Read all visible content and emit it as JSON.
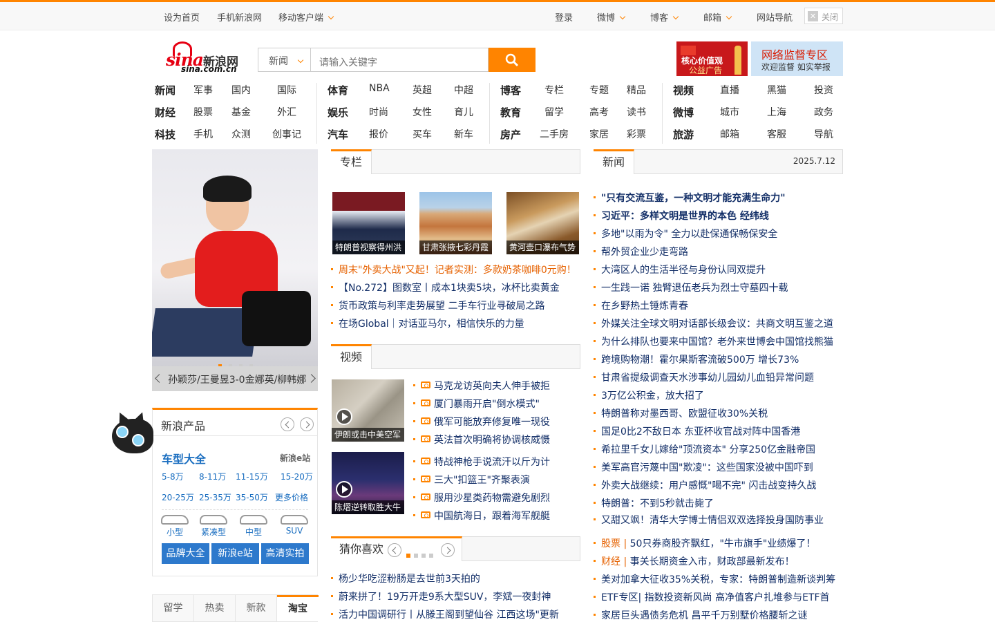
{
  "topbar": {
    "left": [
      "设为首页",
      "手机新浪网",
      "移动客户端"
    ],
    "right": [
      "登录",
      "微博",
      "博客",
      "邮箱",
      "网站导航"
    ],
    "close_label": "关闭"
  },
  "logo": {
    "text": "sina",
    "cn": "新浪网",
    "domain": "sina.com.cn"
  },
  "search": {
    "category": "新闻",
    "placeholder": "请输入关键字"
  },
  "ads": {
    "ad1_line1": "核心价值观",
    "ad1_line2": "公益广告",
    "ad2_line1": "网络监督专区",
    "ad2_line2": "欢迎监督 如实举报"
  },
  "nav": {
    "groups": [
      [
        [
          "新闻",
          "军事",
          "国内",
          "国际"
        ],
        [
          "财经",
          "股票",
          "基金",
          "外汇"
        ],
        [
          "科技",
          "手机",
          "众测",
          "创事记"
        ]
      ],
      [
        [
          "体育",
          "NBA",
          "英超",
          "中超"
        ],
        [
          "娱乐",
          "时尚",
          "女性",
          "育儿"
        ],
        [
          "汽车",
          "报价",
          "买车",
          "新车"
        ]
      ],
      [
        [
          "博客",
          "专栏",
          "专题",
          "精品"
        ],
        [
          "教育",
          "留学",
          "高考",
          "读书"
        ],
        [
          "房产",
          "二手房",
          "家居",
          "彩票"
        ]
      ],
      [
        [
          "视频",
          "直播",
          "黑猫",
          "投资"
        ],
        [
          "微博",
          "城市",
          "上海",
          "政务"
        ],
        [
          "旅游",
          "邮箱",
          "客服",
          "导航"
        ]
      ]
    ]
  },
  "slider": {
    "caption": "孙颖莎/王曼昱3-0金娜英/柳韩娜"
  },
  "products": {
    "title": "新浪产品",
    "heading": "车型大全",
    "site": "新浪e站",
    "prices": [
      "5-8万",
      "8-11万",
      "11-15万",
      "15-20万",
      "20-25万",
      "25-35万",
      "35-50万",
      "更多价格"
    ],
    "cars": [
      "小型",
      "紧凑型",
      "中型",
      "SUV"
    ],
    "buttons": [
      "品牌大全",
      "新浪e站",
      "高清实拍"
    ]
  },
  "bottom_tabs": [
    "留学",
    "热卖",
    "新款",
    "淘宝"
  ],
  "column": {
    "title": "专栏",
    "thumbs": [
      "特朗普视察得州洪",
      "甘肃张掖七彩丹霞",
      "黄河壶口瀑布气势"
    ],
    "items": [
      "周末\"外卖大战\"又起！记者实测：多款奶茶咖啡0元购！",
      "【No.272】图数室丨成本1块卖5块，冰杯比卖黄金",
      "货币政策与利率走势展望 二手车行业寻破局之路",
      "在场Global｜对话亚马尔，相信快乐的力量"
    ]
  },
  "video": {
    "title": "视频",
    "thumbs": [
      "伊朗或击中美空军",
      "陈熠逆转取胜大牛"
    ],
    "items": [
      "马克龙访英向夫人伸手被拒",
      "厦门暴雨开启\"倒水模式\"",
      "俄军可能放弃修复唯一现役",
      "英法首次明确将协调核威慑",
      "特战神枪手说流汗以斤为计",
      "三大\"扣篮王\"齐聚表演",
      "服用沙星类药物需避免剧烈",
      "中国航海日，跟着海军舰艇"
    ]
  },
  "guess": {
    "title": "猜你喜欢",
    "items": [
      "杨少华吃涩粉肠是去世前3天拍的",
      "蔚来拼了！19万开走9系大型SUV，李斌一夜封神",
      "活力中国调研行丨从滕王阁到望仙谷 江西这场\"更新"
    ]
  },
  "news": {
    "title": "新闻",
    "date": "2025.7.12",
    "items": [
      "\"只有交流互鉴，一种文明才能充满生命力\"",
      "习近平：多样文明是世界的本色 经纬线",
      "多地\"以雨为令\" 全力以赴保通保畅保安全",
      "帮外贸企业少走弯路",
      "大湾区人的生活半径与身份认同双提升",
      "一生践一诺 独臂退伍老兵为烈士守墓四十载",
      "在乡野热土锤炼青春",
      "外媒关注全球文明对话部长级会议：共商文明互鉴之道",
      "为什么排队也要来中国馆？老外来世博会中国馆找熊猫",
      "跨境购物潮！霍尔果斯客流破500万 增长73%",
      "甘肃省提级调查天水涉事幼儿园幼儿血铅异常问题",
      "3万亿公积金，放大招了",
      "特朗普称对墨西哥、欧盟征收30%关税",
      "国足0比2不敌日本 东亚杯收官战对阵中国香港",
      "希拉里千女儿嫁给\"顶流资本\" 分享250亿金融帝国",
      "美军高官污蔑中国\"欺凌\"：这些国家没被中国吓到",
      "外卖大战继续：用户感慨\"喝不完\" 闪击战变持久战",
      "特朗普：不到5秒就击毙了",
      "又甜又飒！清华大学博士情侣双双选择投身国防事业"
    ],
    "tagged": [
      {
        "tag": "股票 |",
        "text": "50只券商股齐飘红，\"牛市旗手\"业绩爆了！"
      },
      {
        "tag": "财经 |",
        "text": "事关长期资金入市，财政部最新发布！"
      },
      {
        "tag": "",
        "text": "美对加拿大征收35%关税，专家：特朗普制造新谈判筹"
      },
      {
        "tag": "",
        "text": "ETF专区| 指数投资新风尚 高净值客户扎堆参与ETF首"
      },
      {
        "tag": "",
        "text": "家居巨头遇债务危机 昌平千万别墅价格腰斩之谜"
      }
    ]
  },
  "colors": {
    "accent": "#ff8400",
    "link": "#122e67",
    "button_blue": "#2d79cc"
  }
}
